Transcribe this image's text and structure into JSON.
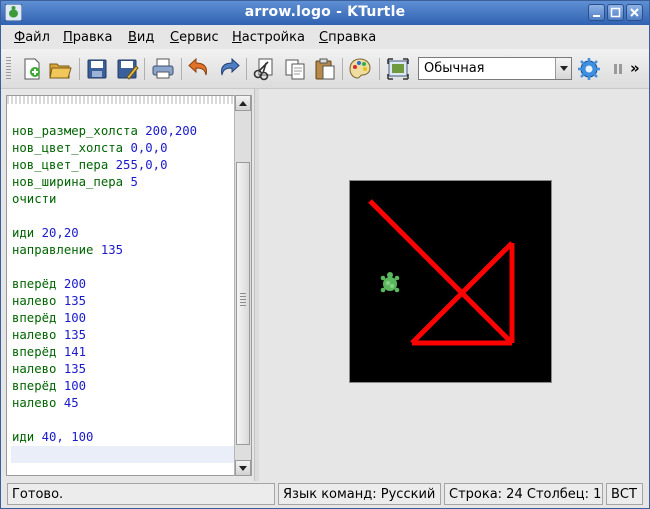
{
  "window": {
    "title": "arrow.logo - KTurtle"
  },
  "menu": [
    {
      "label": "Файл",
      "u": "Ф",
      "rest": "айл"
    },
    {
      "label": "Правка",
      "u": "П",
      "rest": "равка"
    },
    {
      "label": "Вид",
      "u": "В",
      "rest": "ид"
    },
    {
      "label": "Сервис",
      "u": "С",
      "rest": "ервис"
    },
    {
      "label": "Настройка",
      "u": "Н",
      "rest": "астройка"
    },
    {
      "label": "Справка",
      "u": "С",
      "rest": "правка"
    }
  ],
  "toolbar": {
    "speed_value": "Обычная",
    "overflow_label": "»",
    "buttons": [
      "new-icon",
      "open-icon",
      "save-icon",
      "save-as-icon",
      "print-icon",
      "undo-icon",
      "redo-icon",
      "cut-icon",
      "copy-icon",
      "paste-icon",
      "colorpicker-icon",
      "fullscreen-icon",
      "run-icon",
      "pause-icon"
    ]
  },
  "editor": {
    "lines": [
      {
        "kw": "нов_размер_холста",
        "args": "200,200"
      },
      {
        "kw": "нов_цвет_холста",
        "args": "0,0,0"
      },
      {
        "kw": "нов_цвет_пера",
        "args": "255,0,0"
      },
      {
        "kw": "нов_ширина_пера",
        "args": "5"
      },
      {
        "kw": "очисти",
        "args": ""
      },
      {
        "kw": "",
        "args": ""
      },
      {
        "kw": "иди",
        "args": "20,20"
      },
      {
        "kw": "направление",
        "args": "135"
      },
      {
        "kw": "",
        "args": ""
      },
      {
        "kw": "вперёд",
        "args": "200"
      },
      {
        "kw": "налево",
        "args": "135"
      },
      {
        "kw": "вперёд",
        "args": "100"
      },
      {
        "kw": "налево",
        "args": "135"
      },
      {
        "kw": "вперёд",
        "args": "141"
      },
      {
        "kw": "налево",
        "args": "135"
      },
      {
        "kw": "вперёд",
        "args": "100"
      },
      {
        "kw": "налево",
        "args": "45"
      },
      {
        "kw": "",
        "args": ""
      },
      {
        "kw": "иди",
        "args": "40, 100"
      }
    ]
  },
  "canvas": {
    "background": "#000000",
    "pen_color": "#ff0000",
    "turtle_color": "#5cb85c"
  },
  "status": {
    "ready": "Готово.",
    "language": "Язык команд: Русский",
    "position": "Строка: 24 Столбец: 1",
    "mode": "ВСТ"
  },
  "colors": {
    "title_bar": "#3a6dbf",
    "keyword": "#006400",
    "number": "#1a1acc"
  }
}
